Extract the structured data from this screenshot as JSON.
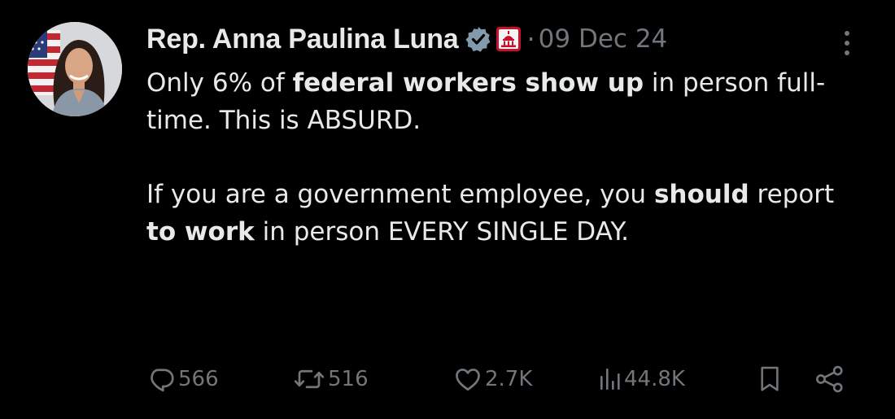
{
  "author": {
    "display_name": "Rep. Anna Paulina Luna",
    "verified_icon": "verified-badge-icon",
    "affiliation_icon": "capitol-dome-icon",
    "separator": "·",
    "date": "09 Dec 24"
  },
  "tweet": {
    "p1": {
      "t1": "Only 6% of ",
      "b1": "federal workers show up",
      "t2": " in person full-time. This is ABSURD."
    },
    "p2": {
      "t1": "If you are a government employee, you ",
      "b1": "should",
      "t2": " report ",
      "b2": "to work",
      "t3": " in person EVERY SINGLE DAY."
    }
  },
  "metrics": {
    "replies": "566",
    "reposts": "516",
    "likes": "2.7K",
    "views": "44.8K"
  },
  "colors": {
    "background": "#000000",
    "text": "#e7e9ea",
    "muted": "#71767b",
    "verified_gray": "#829aab",
    "gov_red": "#c8102e"
  }
}
